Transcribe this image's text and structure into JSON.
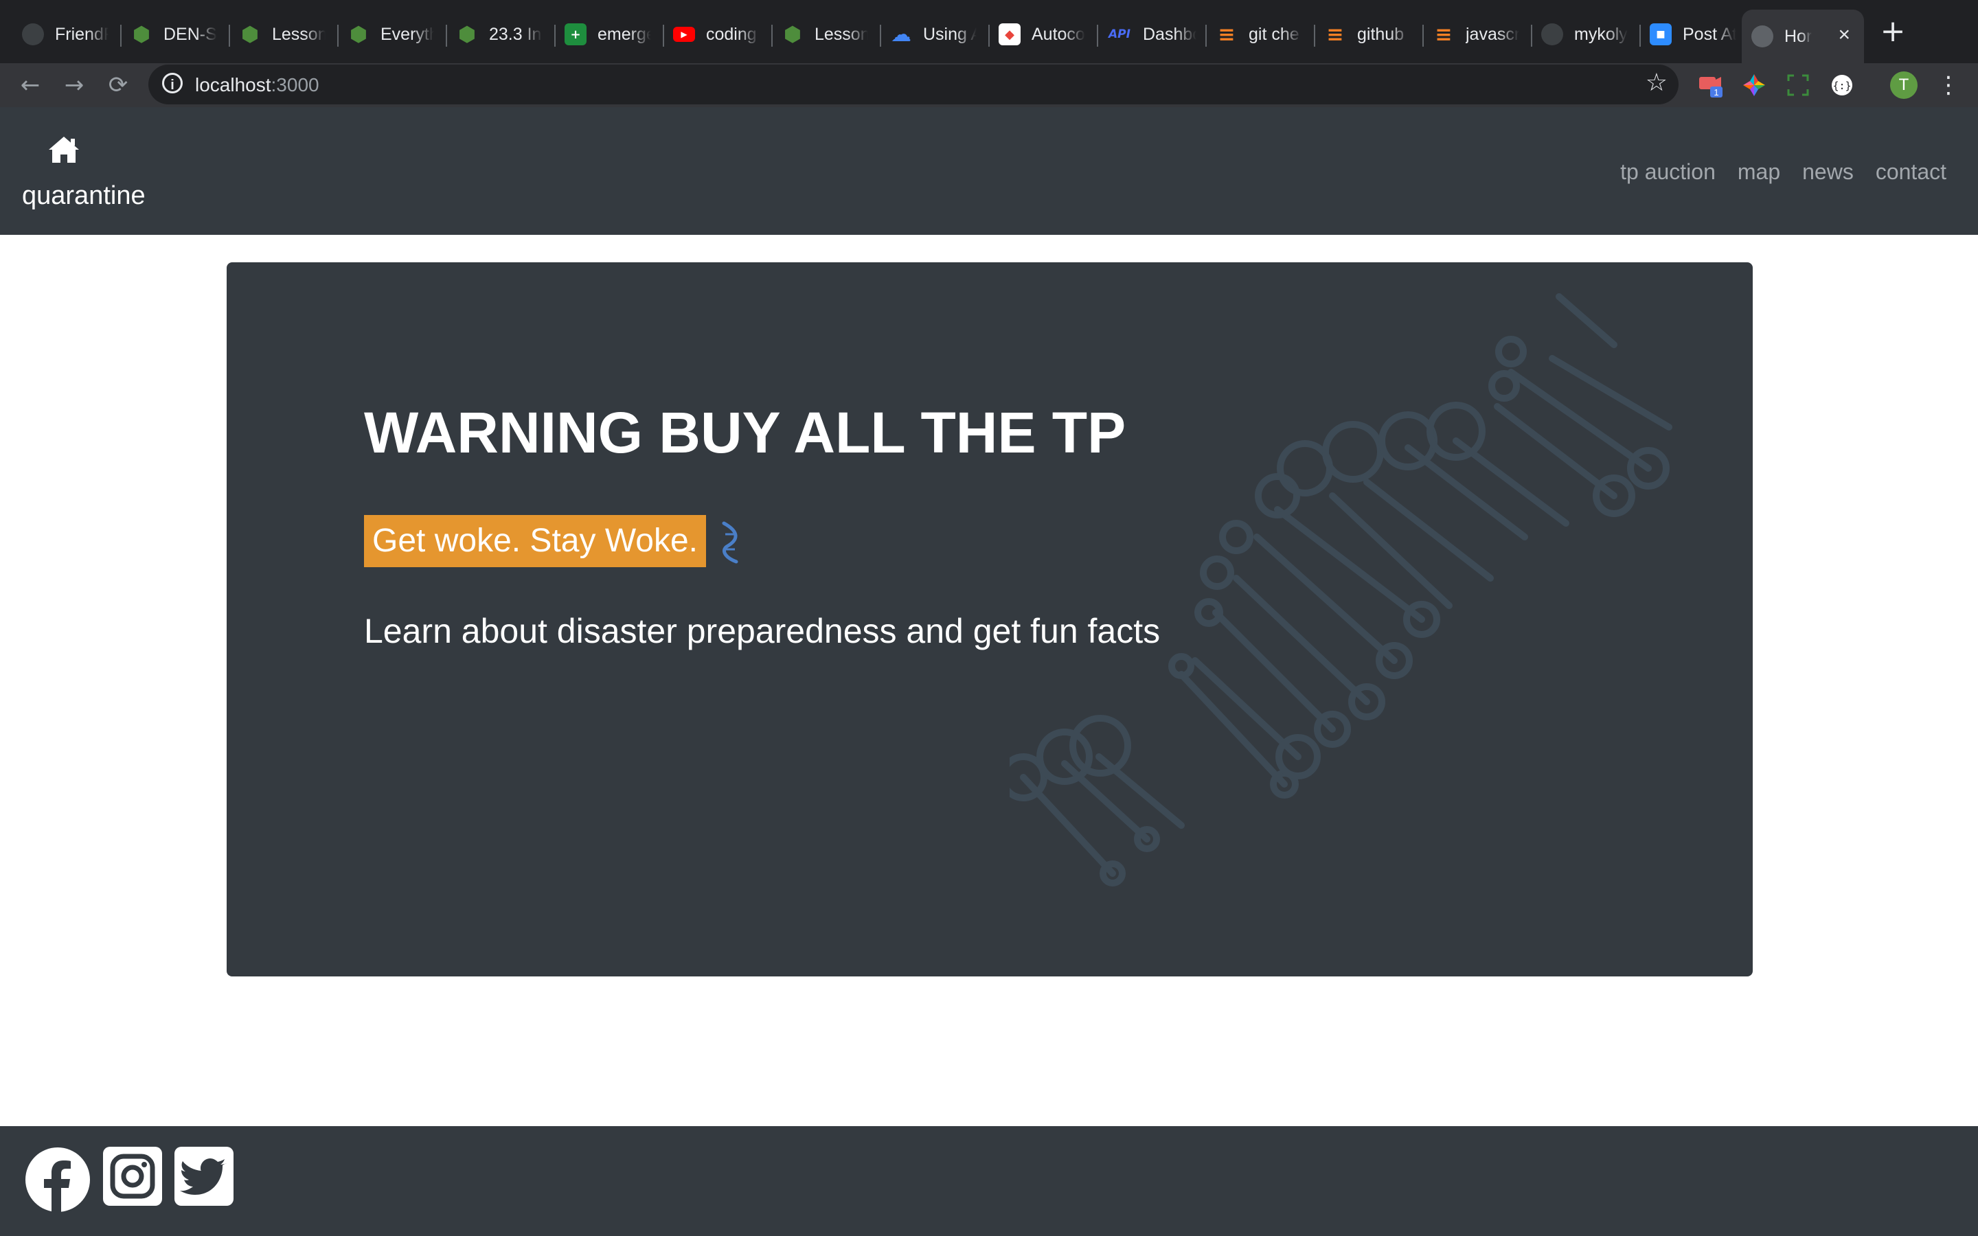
{
  "browser": {
    "tabs": [
      {
        "title": "FriendF",
        "icon": "github-icon",
        "color": "#24292e"
      },
      {
        "title": "DEN-Sa",
        "icon": "cube-icon",
        "color": "#4e8d3c"
      },
      {
        "title": "Lesson",
        "icon": "cube-icon",
        "color": "#4e8d3c"
      },
      {
        "title": "Everyth",
        "icon": "cube-icon",
        "color": "#4e8d3c"
      },
      {
        "title": "23.3 In",
        "icon": "cube-icon",
        "color": "#4e8d3c"
      },
      {
        "title": "emerge",
        "icon": "sheets-icon",
        "color": "#1e8e3e"
      },
      {
        "title": "coding",
        "icon": "youtube-icon",
        "color": "#ff0000"
      },
      {
        "title": "Lesson",
        "icon": "cube-icon",
        "color": "#4e8d3c"
      },
      {
        "title": "Using A",
        "icon": "gcloud-icon",
        "color": "#4285f4"
      },
      {
        "title": "Autoco",
        "icon": "code-icon",
        "color": "#ffffff"
      },
      {
        "title": "Dashbo",
        "icon": "api-icon",
        "color": "#4a6cf7"
      },
      {
        "title": "git che",
        "icon": "stackoverflow-icon",
        "color": "#f48024"
      },
      {
        "title": "github",
        "icon": "stackoverflow-icon",
        "color": "#f48024"
      },
      {
        "title": "javascr",
        "icon": "stackoverflow-icon",
        "color": "#f48024"
      },
      {
        "title": "mykoly",
        "icon": "github-icon",
        "color": "#24292e"
      },
      {
        "title": "Post At",
        "icon": "zoom-icon",
        "color": "#2d8cff"
      },
      {
        "title": "Hor",
        "icon": "globe-icon",
        "color": "#5f6368",
        "active": true
      }
    ],
    "api_badge": "API",
    "url_host": "localhost",
    "url_port": ":3000",
    "avatar_letter": "T",
    "ext_badge": "1"
  },
  "nav": {
    "brand": "quarantine",
    "links": [
      "tp auction",
      "map",
      "news",
      "contact"
    ]
  },
  "hero": {
    "headline": "WARNING BUY ALL THE TP",
    "tagline": "Get woke. Stay Woke.",
    "lead": "Learn about disaster preparedness and get fun facts"
  },
  "footer": {
    "social": [
      "facebook-icon",
      "instagram-icon",
      "twitter-icon"
    ]
  },
  "colors": {
    "nav_bg": "#343a40",
    "tagline_bg": "#e5962f",
    "dna_stroke": "#3d4a55"
  }
}
